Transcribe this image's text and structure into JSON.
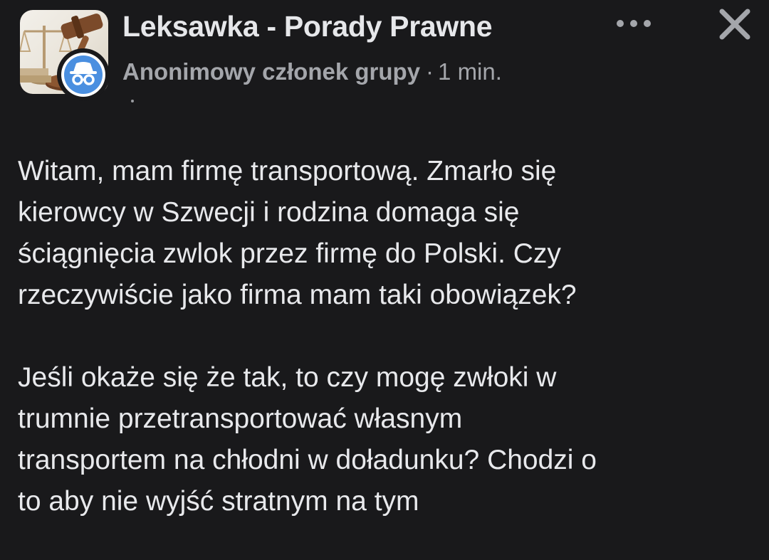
{
  "post": {
    "group_name": "Leksawka - Porady Prawne",
    "author": "Anonimowy członek grupy",
    "separator": "·",
    "time": "1 min.",
    "paragraphs": [
      {
        "lines": [
          "Witam, mam firmę transportową. Zmarło się",
          "kierowcy w Szwecji i rodzina domaga się",
          "ściągnięcia zwlok przez firmę do Polski. Czy",
          "rzeczywiście jako firma mam taki obowiązek?"
        ]
      },
      {
        "lines": [
          "Jeśli okaże się że tak, to czy mogę zwłoki w",
          "trumnie przetransportować własnym",
          "transportem na chłodni w doładunku? Chodzi o",
          "to aby nie wyjść stratnym na tym"
        ]
      }
    ]
  },
  "icons": {
    "group_avatar": "gavel-and-scales-image",
    "member_badge": "anonymous-member-icon",
    "more": "more-options-icon",
    "close": "close-icon",
    "privacy": "privacy-dot-icon"
  },
  "colors": {
    "background": "#19191b",
    "primary_text": "#e6e7ea",
    "secondary_text": "#a4a6ab",
    "badge_blue": "#4a8fe0"
  }
}
